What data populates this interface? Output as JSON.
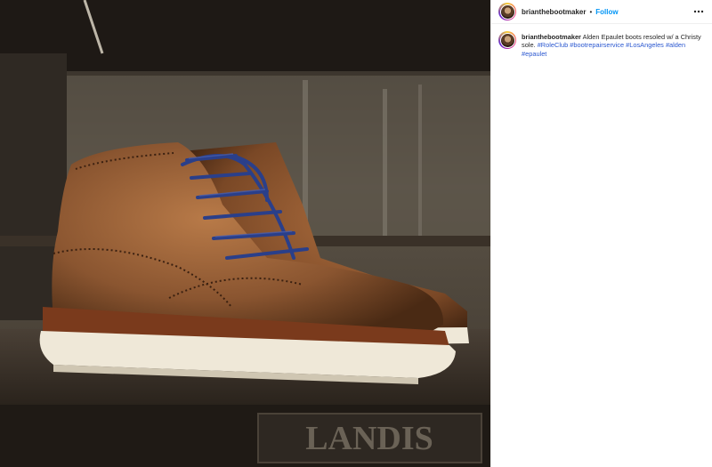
{
  "post": {
    "image_alt": "Brown wingtip boots with blue laces on a wooden shelf",
    "author": {
      "username": "brianthebootmaker",
      "separator": "•",
      "follow_label": "Follow"
    },
    "more_icon": "more-horizontal-icon",
    "caption": {
      "username": "brianthebootmaker",
      "text": "Alden Epaulet boots resoled w/ a Christy sole.",
      "hashtags": [
        "#RoleClub",
        "#bootrepairservice",
        "#LosAngeles",
        "#alden",
        "#epaulet"
      ]
    },
    "photo_text": "LANDIS"
  },
  "colors": {
    "link": "#2b58d0",
    "follow": "#0095f6"
  }
}
